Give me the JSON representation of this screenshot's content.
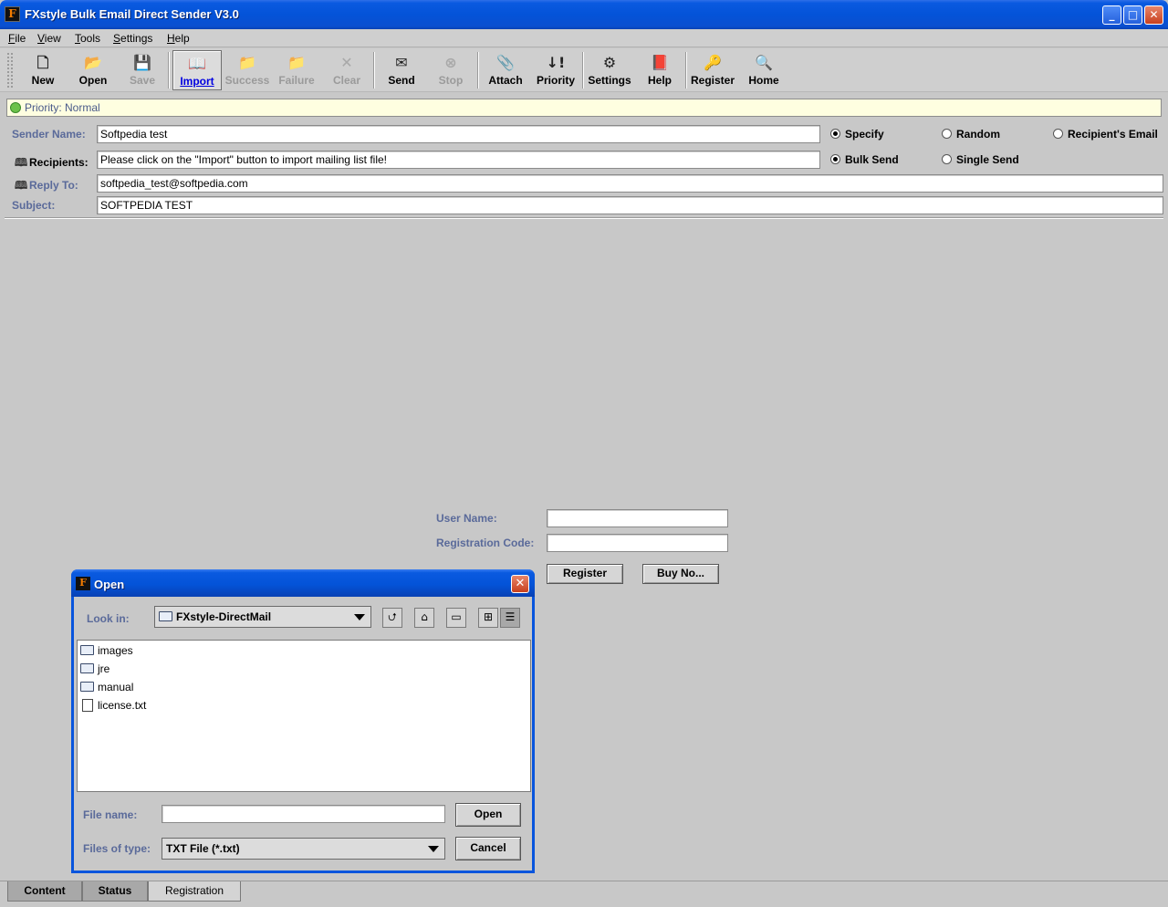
{
  "window": {
    "title": "FXstyle Bulk Email Direct Sender V3.0",
    "logo_letter": "F"
  },
  "menu": [
    "File",
    "View",
    "Tools",
    "Settings",
    "Help"
  ],
  "toolbar": [
    {
      "label": "New",
      "icon": "new-document-icon",
      "glyph": "🗋",
      "enabled": true
    },
    {
      "label": "Open",
      "icon": "open-folder-icon",
      "glyph": "📂",
      "enabled": true
    },
    {
      "label": "Save",
      "icon": "save-disk-icon",
      "glyph": "💾",
      "enabled": false
    },
    {
      "label": "Import",
      "icon": "import-book-icon",
      "glyph": "📖",
      "enabled": true,
      "active": true
    },
    {
      "label": "Success",
      "icon": "success-folder-icon",
      "glyph": "📁",
      "enabled": false
    },
    {
      "label": "Failure",
      "icon": "failure-folder-icon",
      "glyph": "📁",
      "enabled": false
    },
    {
      "label": "Clear",
      "icon": "clear-x-icon",
      "glyph": "✕",
      "enabled": false
    },
    {
      "label": "Send",
      "icon": "send-envelope-icon",
      "glyph": "✉",
      "enabled": true
    },
    {
      "label": "Stop",
      "icon": "stop-circle-icon",
      "glyph": "⊗",
      "enabled": false
    },
    {
      "label": "Attach",
      "icon": "paperclip-icon",
      "glyph": "📎",
      "enabled": true
    },
    {
      "label": "Priority",
      "icon": "priority-exclamation-icon",
      "glyph": "↓!",
      "enabled": true
    },
    {
      "label": "Settings",
      "icon": "gear-icon",
      "glyph": "⚙",
      "enabled": true
    },
    {
      "label": "Help",
      "icon": "help-book-icon",
      "glyph": "📕",
      "enabled": true
    },
    {
      "label": "Register",
      "icon": "register-key-icon",
      "glyph": "🔑",
      "enabled": true
    },
    {
      "label": "Home",
      "icon": "home-magnifier-icon",
      "glyph": "🔍",
      "enabled": true
    }
  ],
  "priority_bar": {
    "text": "Priority: Normal",
    "icon": "priority-dot-icon",
    "color": "#6cc24a"
  },
  "form": {
    "sender_name": {
      "label": "Sender Name:",
      "value": "Softpedia test"
    },
    "recipients": {
      "label": "Recipients:",
      "value": "Please click on the \"Import\" button to import mailing list file!"
    },
    "reply_to": {
      "label": "Reply To:",
      "value": "softpedia_test@softpedia.com"
    },
    "subject": {
      "label": "Subject:",
      "value": "SOFTPEDIA TEST"
    },
    "sender_mode": {
      "options": [
        "Specify",
        "Random",
        "Recipient's Email"
      ],
      "selected": "Specify"
    },
    "send_mode": {
      "options": [
        "Bulk Send",
        "Single Send"
      ],
      "selected": "Bulk Send"
    }
  },
  "registration": {
    "user_name_label": "User Name:",
    "user_name_value": "",
    "reg_code_label": "Registration Code:",
    "reg_code_value": "",
    "register_button": "Register",
    "buy_button": "Buy No..."
  },
  "open_dialog": {
    "title": "Open",
    "look_in_label": "Look in:",
    "look_in_value": "FXstyle-DirectMail",
    "files": [
      {
        "name": "images",
        "type": "folder"
      },
      {
        "name": "jre",
        "type": "folder"
      },
      {
        "name": "manual",
        "type": "folder"
      },
      {
        "name": "license.txt",
        "type": "file"
      }
    ],
    "file_name_label": "File name:",
    "file_name_value": "",
    "files_of_type_label": "Files of type:",
    "files_of_type_value": "TXT File (*.txt)",
    "open_button": "Open",
    "cancel_button": "Cancel"
  },
  "tabs": [
    {
      "label": "Content",
      "selected": false
    },
    {
      "label": "Status",
      "selected": false
    },
    {
      "label": "Registration",
      "selected": true
    }
  ]
}
